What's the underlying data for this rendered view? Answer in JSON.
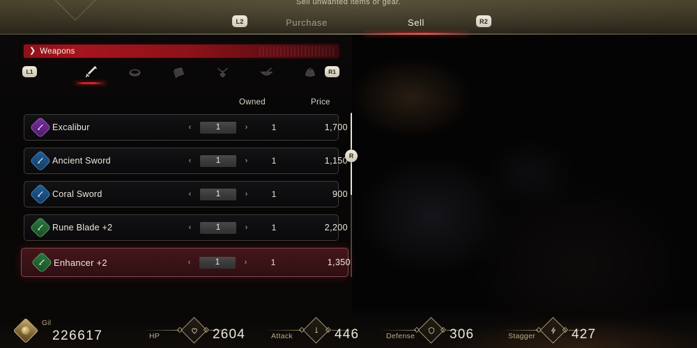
{
  "header": {
    "hint": "Sell unwanted items or gear.",
    "bumper_left": "L2",
    "bumper_right": "R2",
    "tabs": [
      {
        "label": "Purchase",
        "active": false
      },
      {
        "label": "Sell",
        "active": true
      }
    ],
    "accent_color": "#d5232d"
  },
  "category_banner": {
    "chevron": "❯",
    "label": "Weapons"
  },
  "category_strip": {
    "bumper_left": "L1",
    "bumper_right": "R1",
    "icons": [
      {
        "name": "sword-icon",
        "active": true
      },
      {
        "name": "bracelet-icon",
        "active": false
      },
      {
        "name": "shield-icon",
        "active": false
      },
      {
        "name": "necklace-icon",
        "active": false
      },
      {
        "name": "bowl-icon",
        "active": false
      },
      {
        "name": "pouch-icon",
        "active": false
      }
    ]
  },
  "columns": {
    "owned": "Owned",
    "price": "Price"
  },
  "stepper": {
    "left_arrow": "‹",
    "right_arrow": "›"
  },
  "items": [
    {
      "name": "Excalibur",
      "rarity": "purple",
      "quantity": "1",
      "owned": "1",
      "price": "1,700",
      "selected": false
    },
    {
      "name": "Ancient Sword",
      "rarity": "blue",
      "quantity": "1",
      "owned": "1",
      "price": "1,150",
      "selected": false
    },
    {
      "name": "Coral Sword",
      "rarity": "blue",
      "quantity": "1",
      "owned": "1",
      "price": "900",
      "selected": false
    },
    {
      "name": "Rune Blade +2",
      "rarity": "green",
      "quantity": "1",
      "owned": "1",
      "price": "2,200",
      "selected": false
    },
    {
      "name": "Enhancer +2",
      "rarity": "green",
      "quantity": "1",
      "owned": "1",
      "price": "1,350",
      "selected": true
    }
  ],
  "scrollbar": {
    "handle_label": "R"
  },
  "stats": {
    "gil": {
      "label": "Gil",
      "value": "226617"
    },
    "entries": [
      {
        "label": "HP",
        "value": "2604",
        "icon": "heart-icon"
      },
      {
        "label": "Attack",
        "value": "446",
        "icon": "sword-icon"
      },
      {
        "label": "Defense",
        "value": "306",
        "icon": "shield-icon"
      },
      {
        "label": "Stagger",
        "value": "427",
        "icon": "stagger-icon"
      }
    ]
  }
}
